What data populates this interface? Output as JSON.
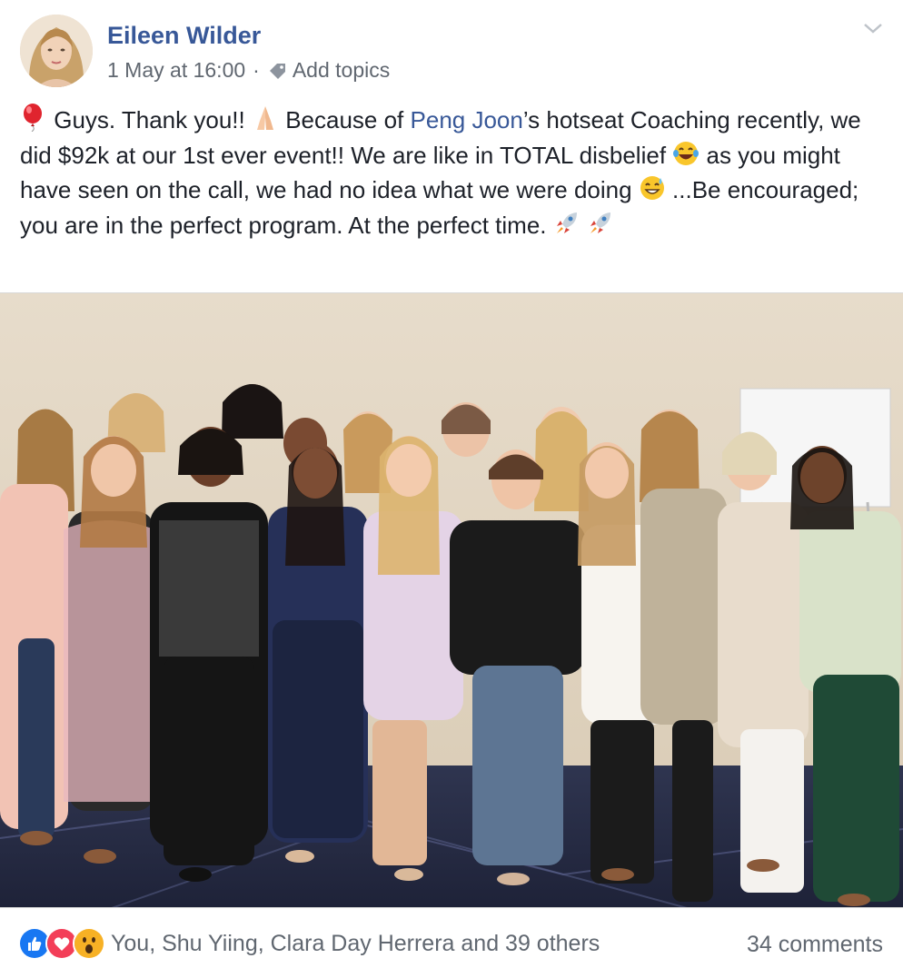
{
  "post": {
    "author": "Eileen Wilder",
    "timestamp": "1 May at 16:00",
    "separator": "·",
    "add_topics": "Add topics",
    "text_parts": {
      "p1": " Guys. Thank you!! ",
      "p2": " Because of ",
      "mention": "Peng Joon",
      "p3": "’s hotseat Coaching recently, we did $92k at our 1st ever event!! We are like in TOTAL disbelief ",
      "p4": " as you might have seen on the call, we had no idea what we were doing ",
      "p5": " ...Be encouraged; you are in the perfect program. At the perfect time. "
    },
    "icons": {
      "balloon": "balloon-emoji",
      "pray": "praying-hands-emoji",
      "laugh": "tears-of-joy-emoji",
      "sweat": "grinning-sweat-emoji",
      "rocket": "rocket-emoji",
      "tag": "tag-icon",
      "chevron": "chevron-down-icon"
    }
  },
  "photo": {
    "description_icon": "group-photo"
  },
  "footer": {
    "reactions": [
      "like",
      "love",
      "wow"
    ],
    "likers": "You, Shu Yiing, Clara Day Herrera and 39 others",
    "comments": "34 comments"
  },
  "colors": {
    "link": "#385898",
    "secondary": "#606770",
    "like": "#1877f2",
    "love": "#f33e58",
    "wow": "#f7b125"
  }
}
